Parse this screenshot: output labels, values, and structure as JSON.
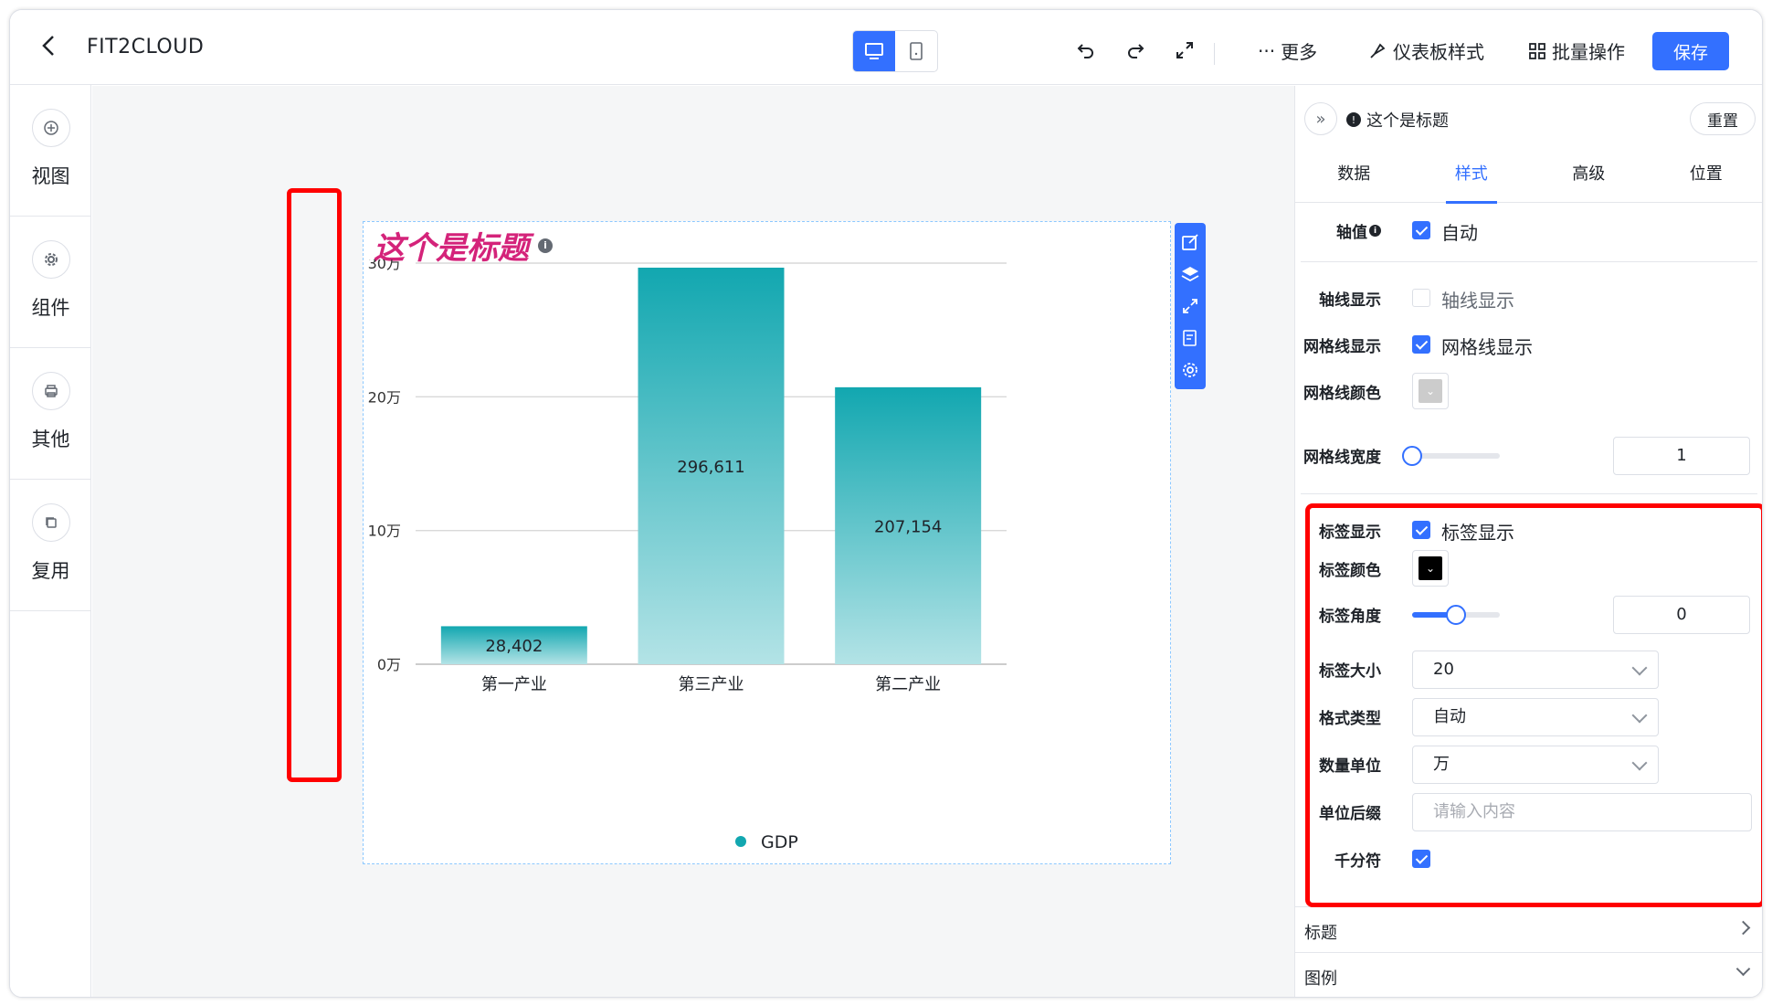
{
  "header": {
    "app_title": "FIT2CLOUD",
    "more_label": "更多",
    "dashboard_style_label": "仪表板样式",
    "batch_label": "批量操作",
    "save_label": "保存"
  },
  "sidebar": {
    "items": [
      {
        "label": "视图",
        "icon": "plus-circle-icon"
      },
      {
        "label": "组件",
        "icon": "gear-icon"
      },
      {
        "label": "其他",
        "icon": "printer-icon"
      },
      {
        "label": "复用",
        "icon": "copy-icon"
      }
    ]
  },
  "chart": {
    "title": "这个是标题",
    "legend": "GDP"
  },
  "chart_data": {
    "type": "bar",
    "categories": [
      "第一产业",
      "第三产业",
      "第二产业"
    ],
    "series": [
      {
        "name": "GDP",
        "values": [
          28402,
          296611,
          207154
        ]
      }
    ],
    "data_labels": [
      "28,402",
      "296,611",
      "207,154"
    ],
    "yticks": [
      "0万",
      "10万",
      "20万",
      "30万"
    ],
    "ylim": [
      0,
      300000
    ],
    "grid": true,
    "legend_position": "bottom",
    "gradient": [
      "#12a7b0",
      "#b3e3e6"
    ]
  },
  "panel": {
    "component_name": "这个是标题",
    "reset_label": "重置",
    "tabs": [
      "数据",
      "样式",
      "高级",
      "位置"
    ],
    "active_tab": "样式",
    "axis_value": {
      "label": "轴值",
      "checkbox_label": "自动",
      "checked": true
    },
    "axis_line": {
      "label": "轴线显示",
      "checkbox_label": "轴线显示",
      "checked": false
    },
    "grid_line": {
      "label": "网格线显示",
      "checkbox_label": "网格线显示",
      "checked": true
    },
    "grid_color": {
      "label": "网格线颜色",
      "value": "#cccccc"
    },
    "grid_width": {
      "label": "网格线宽度",
      "value": "1",
      "fraction": 0.0
    },
    "label_show": {
      "label": "标签显示",
      "checkbox_label": "标签显示",
      "checked": true
    },
    "label_color": {
      "label": "标签颜色",
      "value": "#000000"
    },
    "label_angle": {
      "label": "标签角度",
      "value": "0",
      "fraction": 0.5
    },
    "label_size": {
      "label": "标签大小",
      "value": "20"
    },
    "format_type": {
      "label": "格式类型",
      "value": "自动"
    },
    "quantity_unit": {
      "label": "数量单位",
      "value": "万"
    },
    "unit_suffix": {
      "label": "单位后缀",
      "placeholder": "请输入内容"
    },
    "thousand_sep": {
      "label": "千分符",
      "checked": true
    },
    "sections": [
      "标题",
      "图例"
    ]
  },
  "colors": {
    "accent": "#3370ff",
    "title": "#d4237a",
    "highlight": "#ff0000"
  }
}
